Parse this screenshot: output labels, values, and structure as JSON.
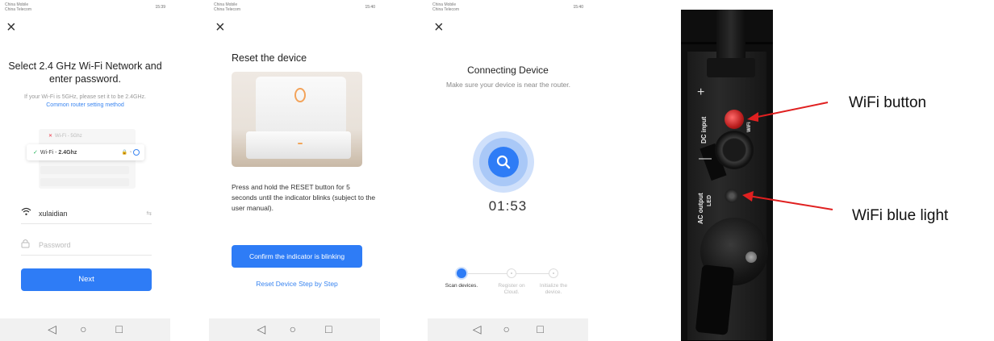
{
  "phones": [
    {
      "statusbar": {
        "carrier1": "China Mobile",
        "carrier2": "China Telecom",
        "right": "15:39"
      },
      "title": "Select 2.4 GHz Wi-Fi Network and enter password.",
      "subtitle": "If your Wi-Fi is 5GHz, please set it to be 2.4GHz.",
      "subtitle_link": "Common router setting method",
      "wifi_5g_label": "Wi-Fi - 5Ghz",
      "wifi_24_prefix": "Wi-Fi - ",
      "wifi_24_band": "2.4Ghz",
      "ssid_value": "xulaidian",
      "password_placeholder": "Password",
      "next_label": "Next"
    },
    {
      "statusbar": {
        "carrier1": "China Mobile",
        "carrier2": "China Telecom",
        "right": "15:40"
      },
      "title": "Reset the device",
      "instructions": "Press and hold the RESET button for 5 seconds until the indicator blinks (subject to the user manual).",
      "confirm_label": "Confirm the indicator is blinking",
      "reset_link": "Reset Device Step by Step"
    },
    {
      "statusbar": {
        "carrier1": "China Mobile",
        "carrier2": "China Telecom",
        "right": "15:40"
      },
      "title": "Connecting Device",
      "subtitle": "Make sure your device is near the router.",
      "timer": "01:53",
      "steps": [
        {
          "label": "Scan devices.",
          "active": true
        },
        {
          "label": "Register on Cloud.",
          "active": false
        },
        {
          "label": "Initialize the device.",
          "active": false
        }
      ]
    }
  ],
  "photo": {
    "dc_label": "DC input",
    "wifi_mark": "WiFi",
    "ac_label": "AC output",
    "led_mark": "LED"
  },
  "annotations": {
    "wifi_button": "WiFi button",
    "wifi_blue_light": "WiFi blue light",
    "arrow_color": "#e02020"
  },
  "accent_color": "#2e7cf6"
}
